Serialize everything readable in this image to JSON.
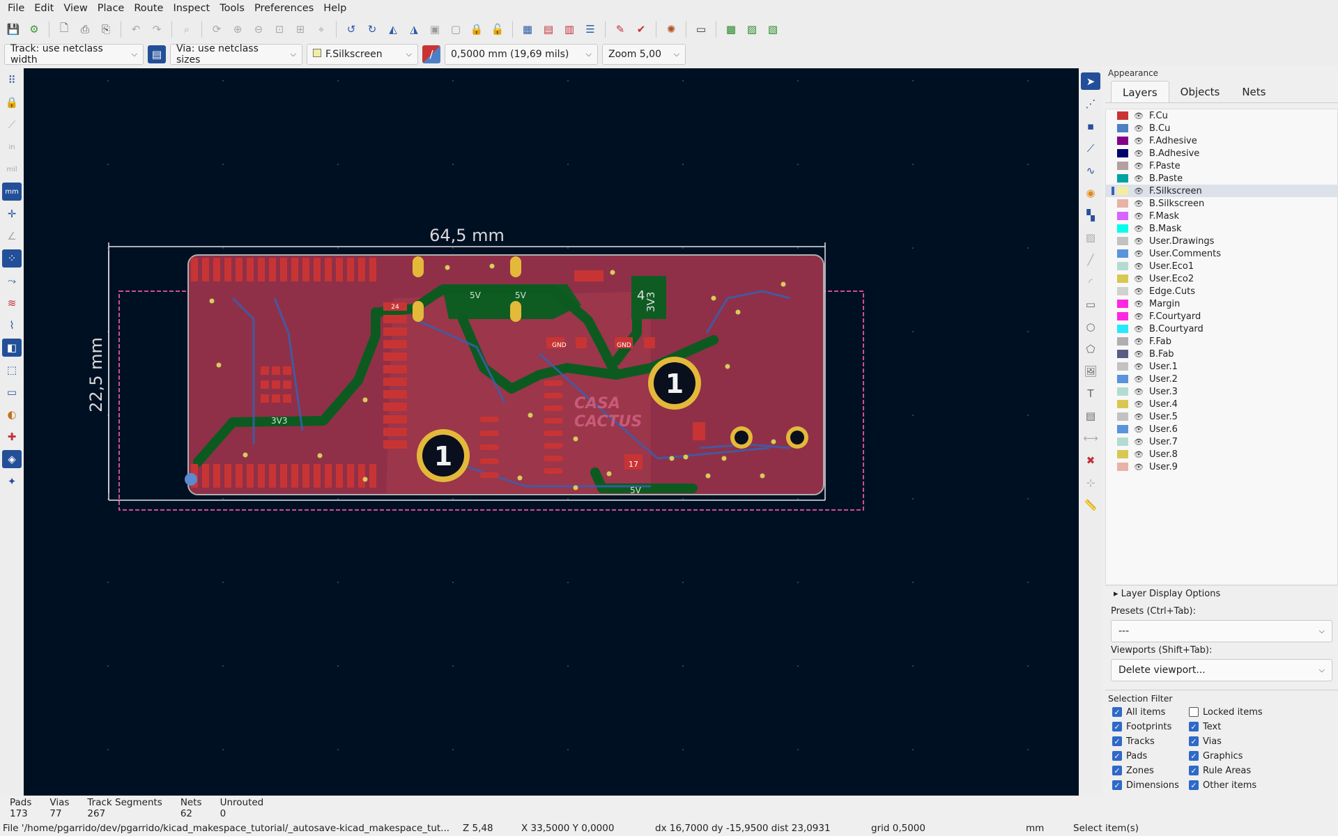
{
  "menubar": {
    "items": [
      "File",
      "Edit",
      "View",
      "Place",
      "Route",
      "Inspect",
      "Tools",
      "Preferences",
      "Help"
    ]
  },
  "optbar": {
    "track": "Track: use netclass width",
    "via": "Via: use netclass sizes",
    "layer": "F.Silkscreen",
    "grid": "0,5000 mm (19,69 mils)",
    "zoom": "Zoom 5,00"
  },
  "board": {
    "width_dim": "64,5 mm",
    "height_dim": "22,5 mm",
    "mount_label": "1",
    "j_label_4": "4",
    "net_3v3": "3V3",
    "net_5v": "5V",
    "net_gnd": "GND",
    "logo_1": "CASA",
    "logo_2": "CACTUS",
    "pad_17": "17",
    "pad_24": "24"
  },
  "appearance": {
    "title": "Appearance",
    "tabs": [
      "Layers",
      "Objects",
      "Nets"
    ],
    "layers": [
      {
        "name": "F.Cu",
        "color": "#c83434"
      },
      {
        "name": "B.Cu",
        "color": "#4d7fc4"
      },
      {
        "name": "F.Adhesive",
        "color": "#84008a"
      },
      {
        "name": "B.Adhesive",
        "color": "#00006e"
      },
      {
        "name": "F.Paste",
        "color": "#b4a0a0"
      },
      {
        "name": "B.Paste",
        "color": "#00a2a2"
      },
      {
        "name": "F.Silkscreen",
        "color": "#f2eda1"
      },
      {
        "name": "B.Silkscreen",
        "color": "#e8b2a7"
      },
      {
        "name": "F.Mask",
        "color": "#d864ff"
      },
      {
        "name": "B.Mask",
        "color": "#02ffee"
      },
      {
        "name": "User.Drawings",
        "color": "#c2c2c2"
      },
      {
        "name": "User.Comments",
        "color": "#5994dc"
      },
      {
        "name": "User.Eco1",
        "color": "#b4dbd2"
      },
      {
        "name": "User.Eco2",
        "color": "#d8c852"
      },
      {
        "name": "Edge.Cuts",
        "color": "#d0d2cd"
      },
      {
        "name": "Margin",
        "color": "#ff26e2"
      },
      {
        "name": "F.Courtyard",
        "color": "#ff26e2"
      },
      {
        "name": "B.Courtyard",
        "color": "#26e9ff"
      },
      {
        "name": "F.Fab",
        "color": "#afafaf"
      },
      {
        "name": "B.Fab",
        "color": "#585d84"
      },
      {
        "name": "User.1",
        "color": "#c2c2c2"
      },
      {
        "name": "User.2",
        "color": "#5994dc"
      },
      {
        "name": "User.3",
        "color": "#b4dbd2"
      },
      {
        "name": "User.4",
        "color": "#d8c852"
      },
      {
        "name": "User.5",
        "color": "#c2c2c2"
      },
      {
        "name": "User.6",
        "color": "#5994dc"
      },
      {
        "name": "User.7",
        "color": "#b4dbd2"
      },
      {
        "name": "User.8",
        "color": "#d8c852"
      },
      {
        "name": "User.9",
        "color": "#e8b2a7"
      }
    ],
    "selected_layer": "F.Silkscreen",
    "layer_display_options": "Layer Display Options",
    "presets_label": "Presets (Ctrl+Tab):",
    "presets_value": "---",
    "viewports_label": "Viewports (Shift+Tab):",
    "viewports_value": "Delete viewport...",
    "selection_filter_title": "Selection Filter",
    "filters": [
      {
        "label": "All items",
        "checked": true
      },
      {
        "label": "Locked items",
        "checked": false
      },
      {
        "label": "Footprints",
        "checked": true
      },
      {
        "label": "Text",
        "checked": true
      },
      {
        "label": "Tracks",
        "checked": true
      },
      {
        "label": "Vias",
        "checked": true
      },
      {
        "label": "Pads",
        "checked": true
      },
      {
        "label": "Graphics",
        "checked": true
      },
      {
        "label": "Zones",
        "checked": true
      },
      {
        "label": "Rule Areas",
        "checked": true
      },
      {
        "label": "Dimensions",
        "checked": true
      },
      {
        "label": "Other items",
        "checked": true
      }
    ]
  },
  "messages": [
    {
      "label": "Pads",
      "value": "173"
    },
    {
      "label": "Vias",
      "value": "77"
    },
    {
      "label": "Track Segments",
      "value": "267"
    },
    {
      "label": "Nets",
      "value": "62"
    },
    {
      "label": "Unrouted",
      "value": "0"
    }
  ],
  "status": {
    "file": "File '/home/pgarrido/dev/pgarrido/kicad_makespace_tutorial/_autosave-kicad_makespace_tut...",
    "zoom": "Z 5,48",
    "coords": "X 33,5000  Y 0,0000",
    "delta": "dx 16,7000  dy -15,9500  dist 23,0931",
    "grid": "grid 0,5000",
    "units": "mm",
    "mode": "Select item(s)"
  }
}
